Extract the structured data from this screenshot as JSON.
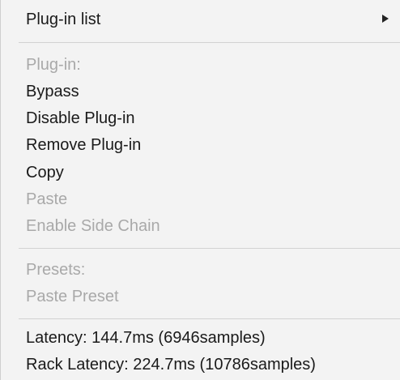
{
  "menu": {
    "plugin_list": "Plug-in list",
    "plugin_header": "Plug-in:",
    "bypass": "Bypass",
    "disable_plugin": "Disable Plug-in",
    "remove_plugin": "Remove Plug-in",
    "copy": "Copy",
    "paste": "Paste",
    "enable_side_chain": "Enable Side Chain",
    "presets_header": "Presets:",
    "paste_preset": "Paste Preset",
    "latency": "Latency: 144.7ms (6946samples)",
    "rack_latency": "Rack Latency: 224.7ms (10786samples)"
  },
  "icons": {
    "submenu_arrow": "chevron-right-icon"
  }
}
